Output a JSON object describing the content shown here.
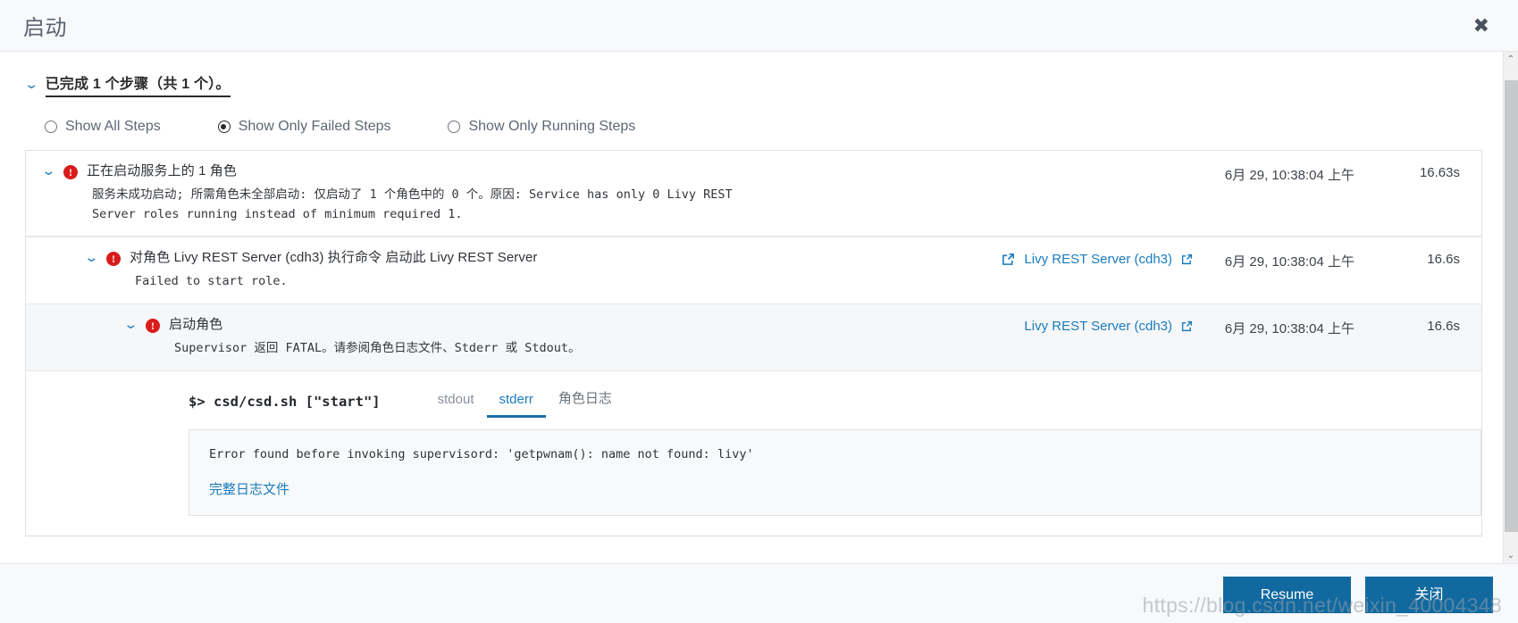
{
  "header": {
    "title": "启动",
    "close_label": "✖"
  },
  "summary": {
    "chevron": "⌄",
    "text": "已完成 1 个步骤（共 1 个）。"
  },
  "filters": [
    {
      "label": "Show All Steps",
      "checked": false
    },
    {
      "label": "Show Only Failed Steps",
      "checked": true
    },
    {
      "label": "Show Only Running Steps",
      "checked": false
    }
  ],
  "steps": [
    {
      "title": "正在启动服务上的 1 角色",
      "description": "服务未成功启动; 所需角色未全部启动: 仅启动了 1 个角色中的 0 个。原因: Service has only 0 Livy REST\nServer roles running instead of minimum required 1.",
      "link": "",
      "timestamp": "6月 29, 10:38:04 上午",
      "duration": "16.63s"
    },
    {
      "title": "对角色 Livy REST Server (cdh3) 执行命令 启动此 Livy REST Server",
      "description": "Failed to start role.",
      "link": "Livy REST Server (cdh3)",
      "timestamp": "6月 29, 10:38:04 上午",
      "duration": "16.6s"
    },
    {
      "title": "启动角色",
      "description": "Supervisor 返回 FATAL。请参阅角色日志文件、Stderr 或 Stdout。",
      "link": "Livy REST Server (cdh3)",
      "timestamp": "6月 29, 10:38:04 上午",
      "duration": "16.6s"
    }
  ],
  "command": {
    "label": "$> csd/csd.sh [\"start\"]",
    "tabs": [
      {
        "label": "stdout",
        "active": false
      },
      {
        "label": "stderr",
        "active": true
      },
      {
        "label": "角色日志",
        "active": false
      }
    ],
    "log_text": "Error found before invoking supervisord: 'getpwnam(): name not found: livy'",
    "log_link": "完整日志文件"
  },
  "footer": {
    "resume_label": "Resume",
    "close_label": "关闭"
  },
  "scrollbar": {
    "up_arrow": "⌃",
    "down_arrow": "⌄"
  },
  "watermark": "https://blog.csdn.net/weixin_40004348",
  "colors": {
    "accent": "#1a7bbd",
    "button": "#11699f",
    "error": "#d91b1b"
  }
}
